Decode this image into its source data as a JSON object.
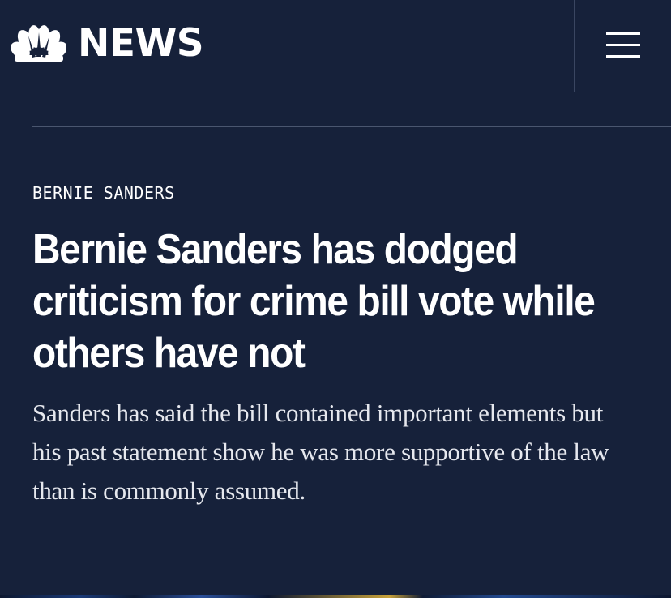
{
  "header": {
    "logo_text": "NEWS",
    "logo_icon": "peacock-icon",
    "menu_icon": "hamburger-menu-icon"
  },
  "article": {
    "section_label": "BERNIE SANDERS",
    "headline": "Bernie Sanders has dodged criticism for crime bill vote while others have not",
    "dek": "Sanders has said the bill contained important elements but his past statement show he was more supportive of the law than is commonly assumed."
  },
  "colors": {
    "background": "#16213a",
    "text": "#ffffff",
    "divider": "#4a566f"
  }
}
